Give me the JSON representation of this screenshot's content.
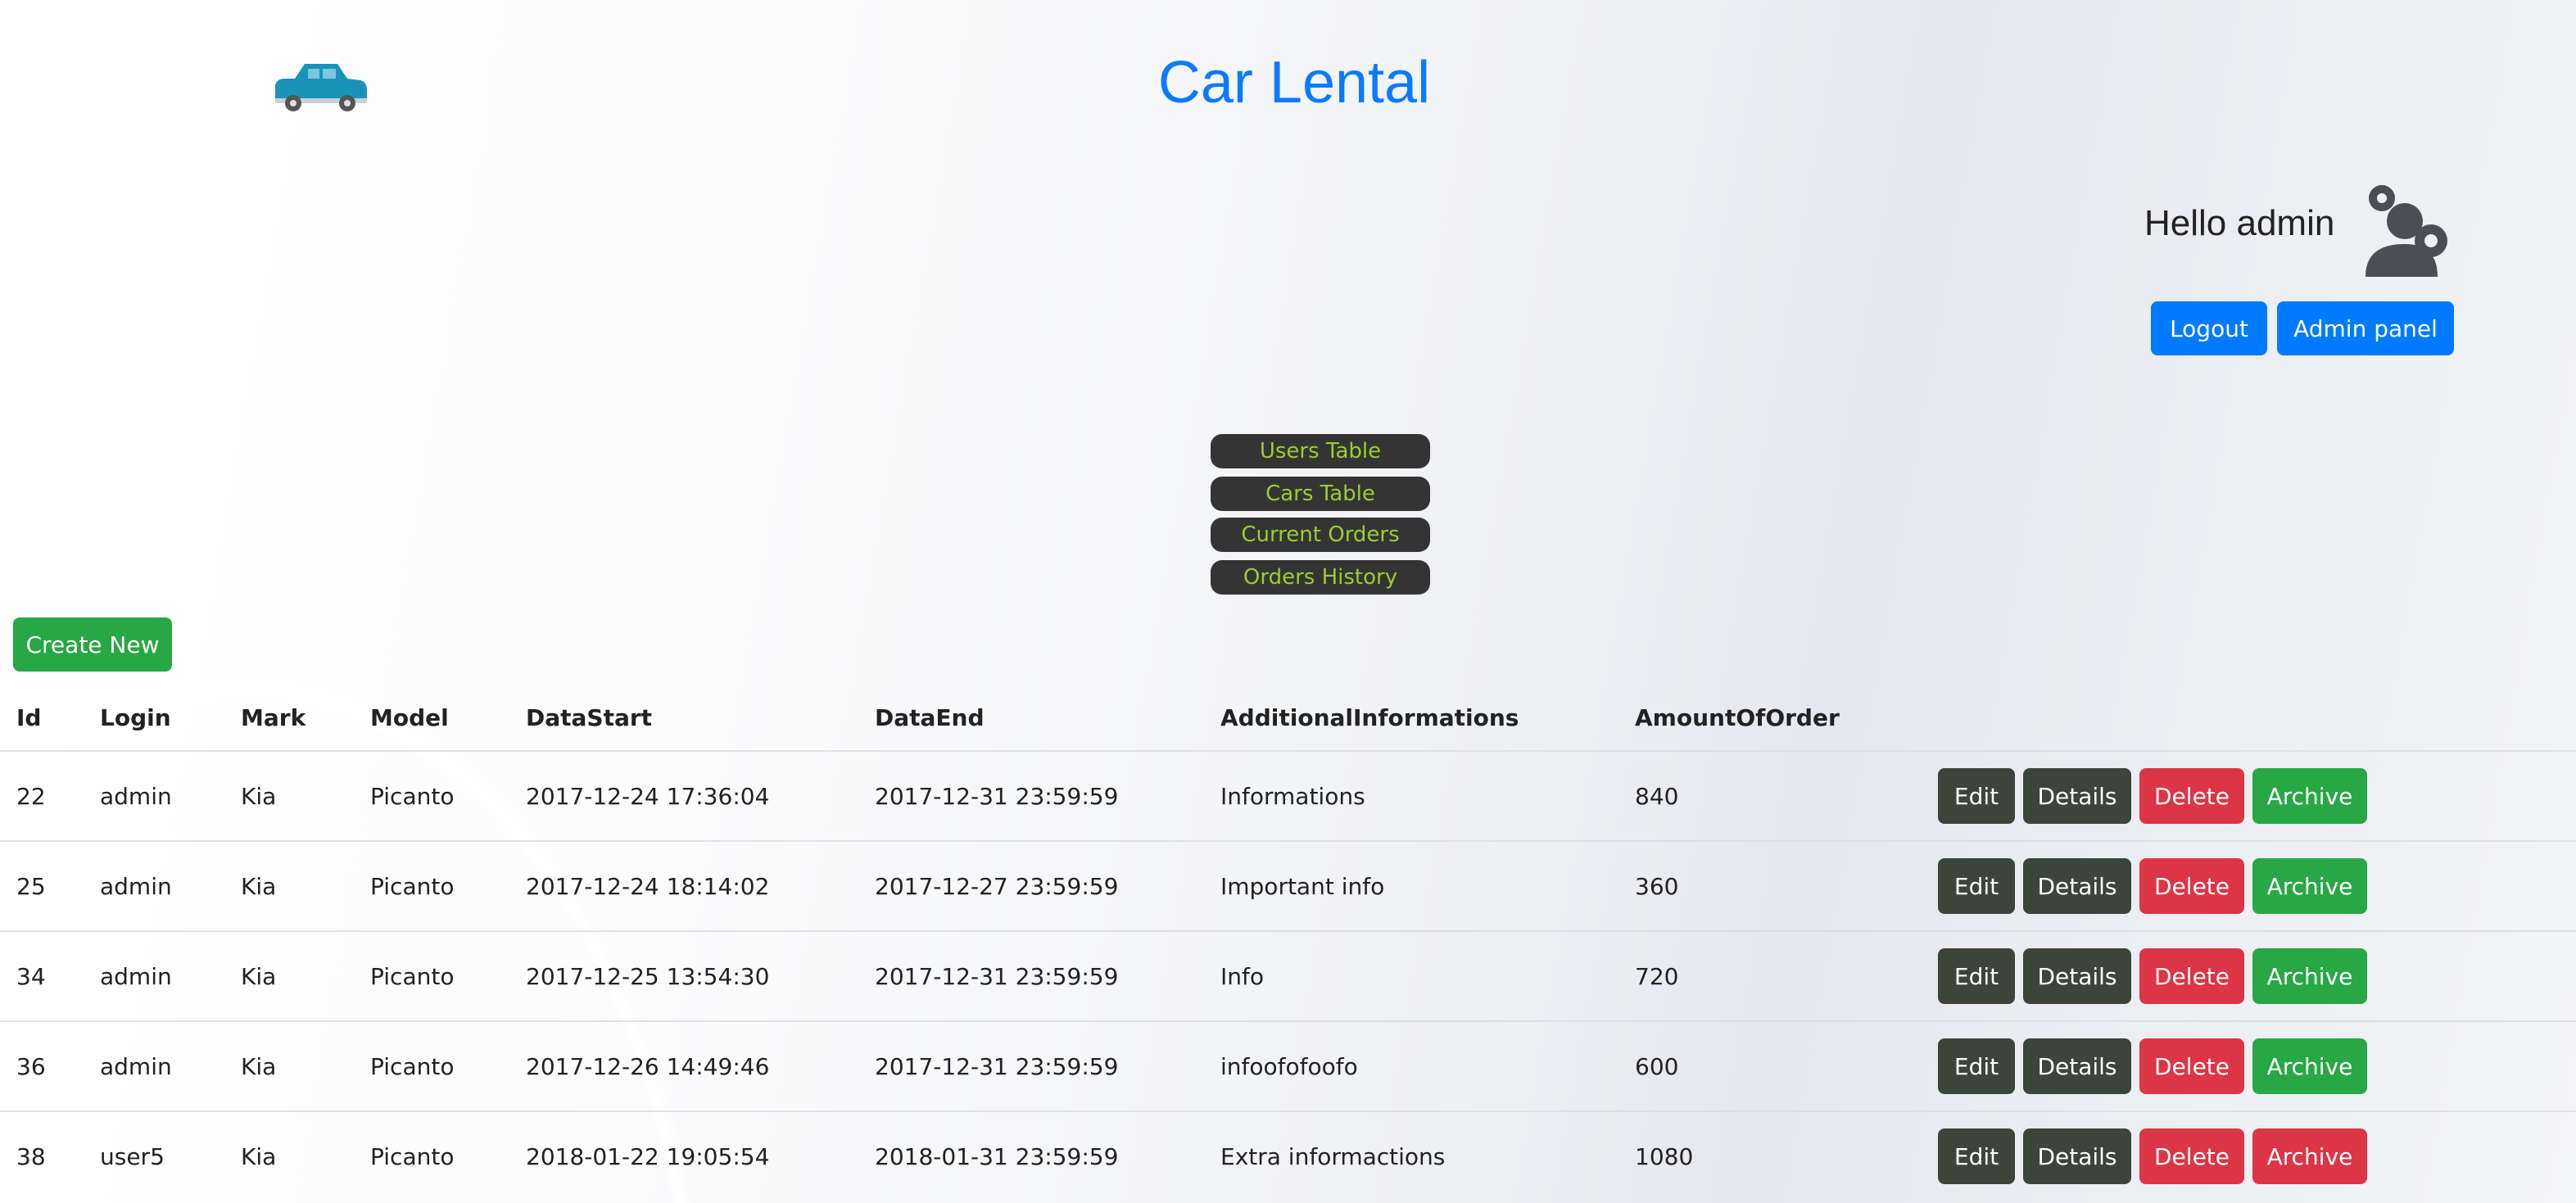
{
  "header": {
    "title": "Car Lental",
    "logo_icon": "car-icon",
    "greeting": "Hello admin",
    "user_icon": "user-gear-icon",
    "logout_label": "Logout",
    "admin_panel_label": "Admin panel"
  },
  "nav": [
    "Users Table",
    "Cars Table",
    "Current Orders",
    "Orders History"
  ],
  "create_new_label": "Create New",
  "table": {
    "columns": [
      "Id",
      "Login",
      "Mark",
      "Model",
      "DataStart",
      "DataEnd",
      "AdditionalInformations",
      "AmountOfOrder"
    ],
    "rows": [
      {
        "id": "22",
        "login": "admin",
        "mark": "Kia",
        "model": "Picanto",
        "start": "2017-12-24 17:36:04",
        "end": "2017-12-31 23:59:59",
        "info": "Informations",
        "amount": "840",
        "archive_color": "#28a745"
      },
      {
        "id": "25",
        "login": "admin",
        "mark": "Kia",
        "model": "Picanto",
        "start": "2017-12-24 18:14:02",
        "end": "2017-12-27 23:59:59",
        "info": "Important info",
        "amount": "360",
        "archive_color": "#28a745"
      },
      {
        "id": "34",
        "login": "admin",
        "mark": "Kia",
        "model": "Picanto",
        "start": "2017-12-25 13:54:30",
        "end": "2017-12-31 23:59:59",
        "info": "Info",
        "amount": "720",
        "archive_color": "#28a745"
      },
      {
        "id": "36",
        "login": "admin",
        "mark": "Kia",
        "model": "Picanto",
        "start": "2017-12-26 14:49:46",
        "end": "2017-12-31 23:59:59",
        "info": "infoofofoofo",
        "amount": "600",
        "archive_color": "#28a745"
      },
      {
        "id": "38",
        "login": "user5",
        "mark": "Kia",
        "model": "Picanto",
        "start": "2018-01-22 19:05:54",
        "end": "2018-01-31 23:59:59",
        "info": "Extra informactions",
        "amount": "1080",
        "archive_color": "#dc3545"
      }
    ],
    "actions": {
      "edit": "Edit",
      "details": "Details",
      "delete": "Delete",
      "archive": "Archive"
    }
  },
  "colors": {
    "primary": "#007bff",
    "success": "#28a745",
    "danger": "#dc3545",
    "dark": "#3b4539",
    "nav_text": "#9acd32"
  }
}
